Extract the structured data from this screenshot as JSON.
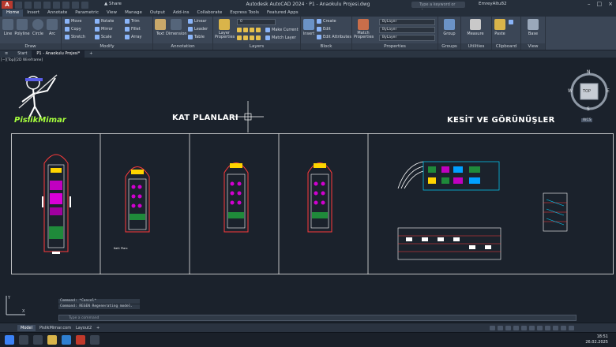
{
  "app": {
    "title": "Autodesk AutoCAD 2024 · P1 - Anaokulu Projesi.dwg",
    "app_button": "A",
    "share_label": "Share",
    "search_placeholder": "Type a keyword or phrase",
    "user_name": "EmreyAltu82"
  },
  "ribbon_tabs": [
    "Home",
    "Insert",
    "Annotate",
    "Parametric",
    "View",
    "Manage",
    "Output",
    "Add-ins",
    "Collaborate",
    "Express Tools",
    "Featured Apps"
  ],
  "ribbon": {
    "draw": {
      "title": "Draw",
      "items": [
        "Line",
        "Polyline",
        "Circle",
        "Arc"
      ]
    },
    "modify": {
      "title": "Modify",
      "items": [
        "Move",
        "Copy",
        "Stretch",
        "Rotate",
        "Mirror",
        "Scale",
        "Trim",
        "Fillet",
        "Array"
      ]
    },
    "annotation": {
      "title": "Annotation",
      "items": [
        "Text",
        "Dimension",
        "Linear",
        "Leader",
        "Table"
      ]
    },
    "layers": {
      "title": "Layers",
      "big": "Layer Properties",
      "items": [
        "Make Current",
        "Match Layer"
      ],
      "layer_value": "0"
    },
    "block": {
      "title": "Block",
      "big": "Insert",
      "items": [
        "Create",
        "Edit",
        "Edit Attributes"
      ]
    },
    "properties": {
      "title": "Properties",
      "big": "Match Properties",
      "color": "ByLayer",
      "linetype": "ByLayer",
      "lineweight": "ByLayer"
    },
    "groups": {
      "title": "Groups",
      "big": "Group"
    },
    "utilities": {
      "title": "Utilities",
      "big": "Measure"
    },
    "clipboard": {
      "title": "Clipboard",
      "big": "Paste"
    },
    "view": {
      "title": "View",
      "big": "Base"
    }
  },
  "file_tabs": [
    "Start",
    "P1 - Anaokulu Projesi*"
  ],
  "viewport_label": "[−][Top][2D Wireframe]",
  "viewcube": {
    "n": "N",
    "s": "S",
    "e": "E",
    "w": "W",
    "face": "TOP",
    "ucs": "WCS"
  },
  "drawing": {
    "title_left": "KAT PLANLARI",
    "title_right": "KESİT VE GÖRÜNÜŞLER",
    "logo_text": "PislikMimar",
    "sheet_note": "Kat1 Planı"
  },
  "command": {
    "history": [
      "Command: *Cancel*",
      "Command: REGEN Regenerating model."
    ],
    "placeholder": "Type a command"
  },
  "status_tabs": [
    "Model",
    "PislikMimar.com",
    "Layout2"
  ],
  "clock": {
    "time": "18:51",
    "date": "26.02.2025"
  },
  "colors": {
    "accent": "#3b82f6",
    "magenta": "#e600e6",
    "green": "#22c55e",
    "yellow": "#ffd400",
    "cyan": "#00d4ff",
    "canvas": "#1b222c"
  }
}
